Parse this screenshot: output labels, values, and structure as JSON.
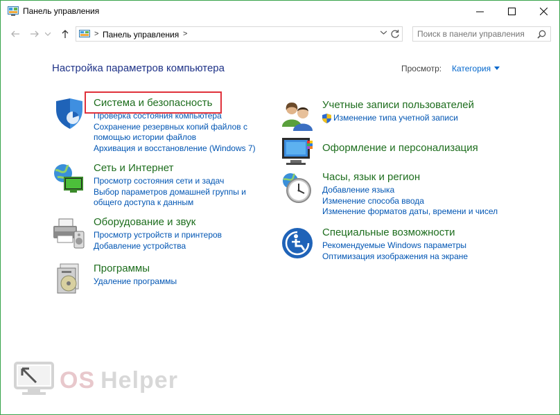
{
  "window": {
    "title": "Панель управления",
    "frame_color": "#36a34a"
  },
  "address": {
    "path": "Панель управления",
    "separator": ">",
    "separator_end": ">"
  },
  "search": {
    "placeholder": "Поиск в панели управления"
  },
  "header": {
    "heading": "Настройка параметров компьютера",
    "view_by_label": "Просмотр:",
    "view_by_value": "Категория"
  },
  "categories": {
    "security": {
      "title": "Система и безопасность",
      "icon": "security-shield-icon",
      "links": [
        "Проверка состояния компьютера",
        "Сохранение резервных копий файлов с",
        "помощью истории файлов",
        "Архивация и восстановление (Windows 7)"
      ]
    },
    "network": {
      "title": "Сеть и Интернет",
      "icon": "network-globe-icon",
      "links": [
        "Просмотр состояния сети и задач",
        "Выбор параметров домашней группы и",
        "общего доступа к данным"
      ]
    },
    "hardware": {
      "title": "Оборудование и звук",
      "icon": "printer-icon",
      "links": [
        "Просмотр устройств и принтеров",
        "Добавление устройства"
      ]
    },
    "programs": {
      "title": "Программы",
      "icon": "programs-disc-icon",
      "links": [
        "Удаление программы"
      ]
    },
    "accounts": {
      "title": "Учетные записи пользователей",
      "icon": "users-icon",
      "links": [
        "Изменение типа учетной записи"
      ]
    },
    "appearance": {
      "title": "Оформление и персонализация",
      "icon": "monitor-palette-icon",
      "links": []
    },
    "clock": {
      "title": "Часы, язык и регион",
      "icon": "clock-globe-icon",
      "links": [
        "Добавление языка",
        "Изменение способа ввода",
        "Изменение форматов даты, времени и чисел"
      ]
    },
    "ease": {
      "title": "Специальные возможности",
      "icon": "ease-of-access-icon",
      "links": [
        "Рекомендуемые Windows параметры",
        "Оптимизация изображения на экране"
      ]
    }
  },
  "watermark": {
    "text_os": "OS",
    "text_helper": "Helper"
  },
  "colors": {
    "heading": "#1e3287",
    "category_title": "#1d6d1d",
    "link": "#0055b3",
    "highlight": "#e0303a"
  }
}
